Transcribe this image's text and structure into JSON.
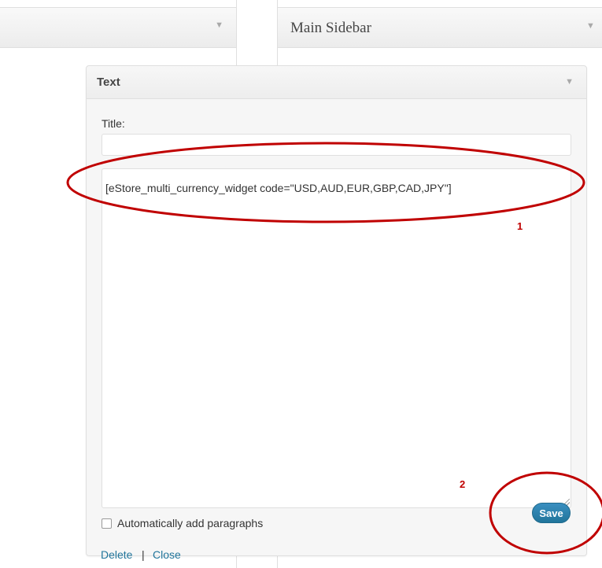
{
  "sidebar": {
    "title": "Main Sidebar",
    "toggle_icon": "triangle-down-icon"
  },
  "widget": {
    "title": "Text",
    "title_field_label": "Title:",
    "title_field_value": "",
    "content_value": "[eStore_multi_currency_widget code=\"USD,AUD,EUR,GBP,CAD,JPY\"]",
    "auto_paragraphs_label": "Automatically add paragraphs",
    "auto_paragraphs_checked": false,
    "delete_label": "Delete",
    "separator": "|",
    "close_label": "Close",
    "save_label": "Save"
  },
  "annotations": {
    "step1": "1",
    "step2": "2",
    "circle_color": "#c00000"
  },
  "colors": {
    "link": "#21759b",
    "save_button": "#21759b"
  }
}
